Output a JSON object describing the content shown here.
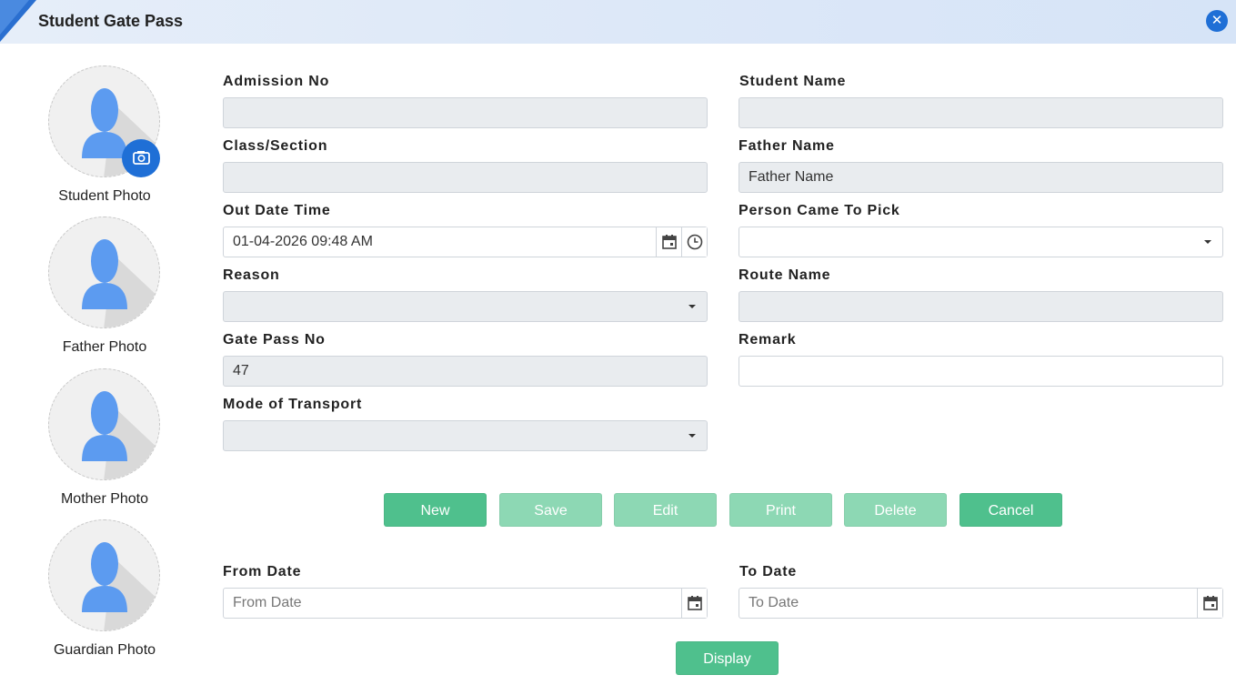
{
  "header": {
    "title": "Student Gate Pass",
    "close_icon": "close-icon"
  },
  "photos": {
    "student_label": "Student Photo",
    "father_label": "Father Photo",
    "mother_label": "Mother Photo",
    "guardian_label": "Guardian Photo"
  },
  "form": {
    "admission_no": {
      "label": "Admission No",
      "value": ""
    },
    "student_name": {
      "label": "Student Name",
      "value": ""
    },
    "class_section": {
      "label": "Class/Section",
      "value": ""
    },
    "father_name": {
      "label": "Father Name",
      "value": "Father Name"
    },
    "out_date_time": {
      "label": "Out Date Time",
      "value": "01-04-2026 09:48 AM"
    },
    "person_came": {
      "label": "Person Came To Pick",
      "value": ""
    },
    "reason": {
      "label": "Reason",
      "value": ""
    },
    "route_name": {
      "label": "Route Name",
      "value": ""
    },
    "gate_pass_no": {
      "label": "Gate Pass No",
      "value": "47"
    },
    "remark": {
      "label": "Remark",
      "value": ""
    },
    "mode_of_transport": {
      "label": "Mode of Transport",
      "value": ""
    }
  },
  "buttons": {
    "new": "New",
    "save": "Save",
    "edit": "Edit",
    "print": "Print",
    "delete": "Delete",
    "cancel": "Cancel",
    "display": "Display"
  },
  "filter": {
    "from_date": {
      "label": "From Date",
      "placeholder": "From Date"
    },
    "to_date": {
      "label": "To Date",
      "placeholder": "To Date"
    }
  },
  "colors": {
    "accent_blue": "#1f6fd6",
    "button_green": "#4fc08d",
    "button_green_disabled": "#8dd8b4"
  }
}
